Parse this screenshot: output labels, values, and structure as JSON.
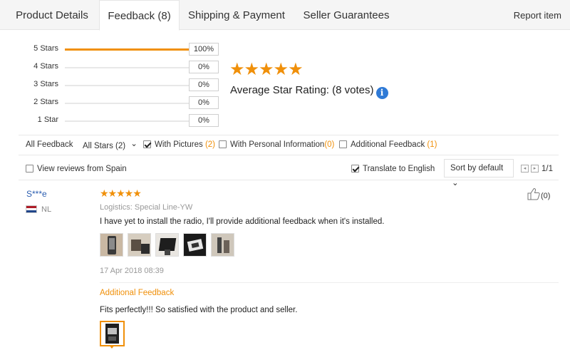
{
  "tabs": [
    {
      "label": "Product Details"
    },
    {
      "label": "Feedback (8)"
    },
    {
      "label": "Shipping & Payment"
    },
    {
      "label": "Seller Guarantees"
    }
  ],
  "report_label": "Report item",
  "rating_rows": [
    {
      "label": "5 Stars",
      "pct": "100%",
      "fraction": 1.0
    },
    {
      "label": "4 Stars",
      "pct": "0%",
      "fraction": 0
    },
    {
      "label": "3 Stars",
      "pct": "0%",
      "fraction": 0
    },
    {
      "label": "2 Stars",
      "pct": "0%",
      "fraction": 0
    },
    {
      "label": "1 Star",
      "pct": "0%",
      "fraction": 0
    }
  ],
  "summary": {
    "stars": "★★★★★",
    "avg_label": "Average Star Rating:",
    "votes": "(8 votes)",
    "info_glyph": "i"
  },
  "filters": {
    "all_feedback": "All Feedback",
    "all_stars": "All Stars (2)",
    "chevron": "⌄",
    "with_pictures": {
      "label": "With Pictures",
      "count": "(2)",
      "checked": true
    },
    "with_personal": {
      "label": "With Personal Information",
      "count": "(0)",
      "checked": false
    },
    "additional": {
      "label": "Additional Feedback",
      "count": "(1)",
      "checked": false
    }
  },
  "options": {
    "view_from": {
      "label": "View reviews from Spain",
      "checked": false
    },
    "translate": {
      "label": "Translate to English",
      "checked": true
    },
    "sort_label": "Sort by default",
    "sort_chevron": "⌄",
    "prev_glyph": "◂",
    "next_glyph": "▸",
    "page": "1/1"
  },
  "review": {
    "user": "S***e",
    "country": "NL",
    "stars": "★★★★★",
    "logistics": "Logistics: Special Line-YW",
    "text": "I have yet to install the radio, I'll provide additional feedback when it's installed.",
    "date": "17 Apr 2018 08:39",
    "likes": "(0)",
    "thumb_count": 5,
    "additional_title": "Additional Feedback",
    "additional_text": "Fits perfectly!!! So satisfied with the product and seller."
  },
  "colors": {
    "accent": "#f0900a",
    "link": "#2a5db0",
    "info": "#2f7ad6"
  }
}
